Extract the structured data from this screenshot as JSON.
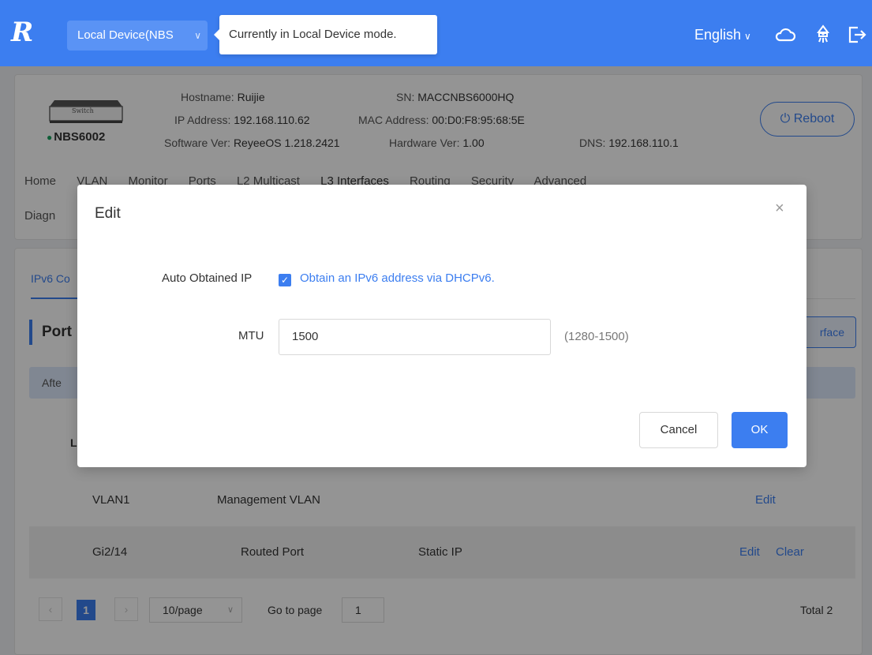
{
  "header": {
    "logo": "R",
    "device_selector": "Local Device(NBS",
    "tooltip": "Currently in Local Device mode.",
    "language": "English"
  },
  "device": {
    "image_label": "Switch",
    "model": "NBS6002",
    "hostname_label": "Hostname:",
    "hostname": "Ruijie",
    "ip_label": "IP Address:",
    "ip": "192.168.110.62",
    "software_label": "Software Ver:",
    "software": "ReyeeOS 1.218.2421",
    "sn_label": "SN:",
    "sn": "MACCNBS6000HQ",
    "mac_label": "MAC Address:",
    "mac": "00:D0:F8:95:68:5E",
    "hardware_label": "Hardware Ver:",
    "hardware": "1.00",
    "dns_label": "DNS:",
    "dns": "192.168.110.1",
    "reboot_label": "Reboot"
  },
  "nav": {
    "row1": [
      "Home",
      "VLAN",
      "Monitor",
      "Ports",
      "L2 Multicast",
      "L3 Interfaces",
      "Routing",
      "Security",
      "Advanced"
    ],
    "row2": [
      "Diagn"
    ]
  },
  "content": {
    "subtab": "IPv6 Co",
    "section_title": "Port",
    "add_button": "rface",
    "notice": "Afte",
    "table_header_partial": "L",
    "rows": [
      {
        "port": "VLAN1",
        "type": "Management VLAN",
        "mode": "",
        "actions": [
          "Edit"
        ]
      },
      {
        "port": "Gi2/14",
        "type": "Routed Port",
        "mode": "Static IP",
        "actions": [
          "Edit",
          "Clear"
        ]
      }
    ],
    "pagination": {
      "current_page": "1",
      "page_size": "10/page",
      "goto_label": "Go to page",
      "goto_value": "1",
      "total": "Total 2"
    }
  },
  "modal": {
    "title": "Edit",
    "auto_ip_label": "Auto Obtained IP",
    "auto_ip_checked": true,
    "auto_ip_text": "Obtain an IPv6 address via DHCPv6.",
    "mtu_label": "MTU",
    "mtu_value": "1500",
    "mtu_hint": "(1280-1500)",
    "cancel_label": "Cancel",
    "ok_label": "OK"
  },
  "colors": {
    "accent": "#3c7ef0",
    "status_online": "#1aa260"
  }
}
